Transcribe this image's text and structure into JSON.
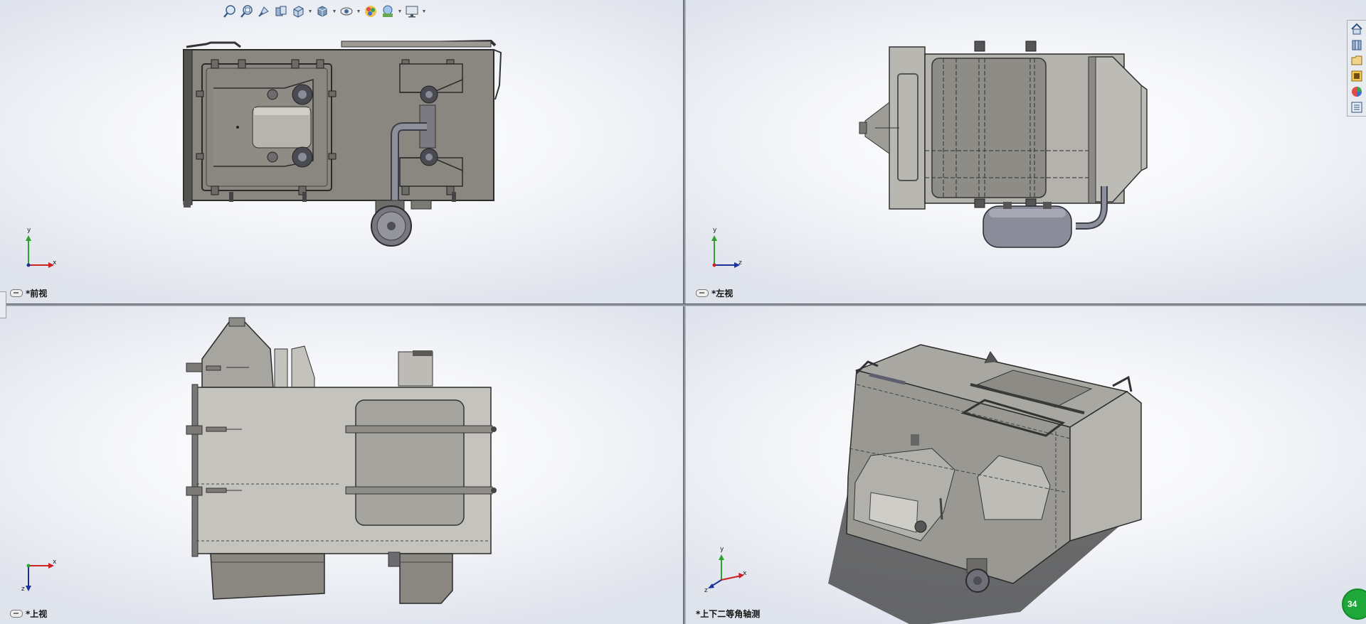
{
  "viewports": {
    "front": {
      "label": "*前视",
      "axes": {
        "up": "y",
        "right": "x"
      }
    },
    "left": {
      "label": "*左视",
      "axes": {
        "up": "y",
        "right": "z"
      }
    },
    "top": {
      "label": "*上视",
      "axes": {
        "right": "x",
        "down": "z"
      }
    },
    "iso": {
      "label": "*上下二等角轴测",
      "axes": {
        "up": "y",
        "right": "x",
        "left": "z"
      }
    }
  },
  "toolbar": {
    "items": [
      "zoom-to-fit-icon",
      "zoom-to-area-icon",
      "previous-view-icon",
      "section-view-icon",
      "view-orientation-icon",
      "display-style-icon",
      "hide-show-items-icon",
      "edit-appearance-icon",
      "apply-scene-icon",
      "view-settings-icon"
    ]
  },
  "task_pane": {
    "items": [
      "home-icon",
      "design-library-icon",
      "file-explorer-icon",
      "view-palette-icon",
      "appearances-icon",
      "custom-properties-icon"
    ]
  },
  "status_badge": {
    "text": "34"
  },
  "colors": {
    "model_gray": "#8a8780",
    "model_light": "#b9b7b2",
    "viewport_bg": "#f4f5f8",
    "separator": "#8a8f98"
  }
}
